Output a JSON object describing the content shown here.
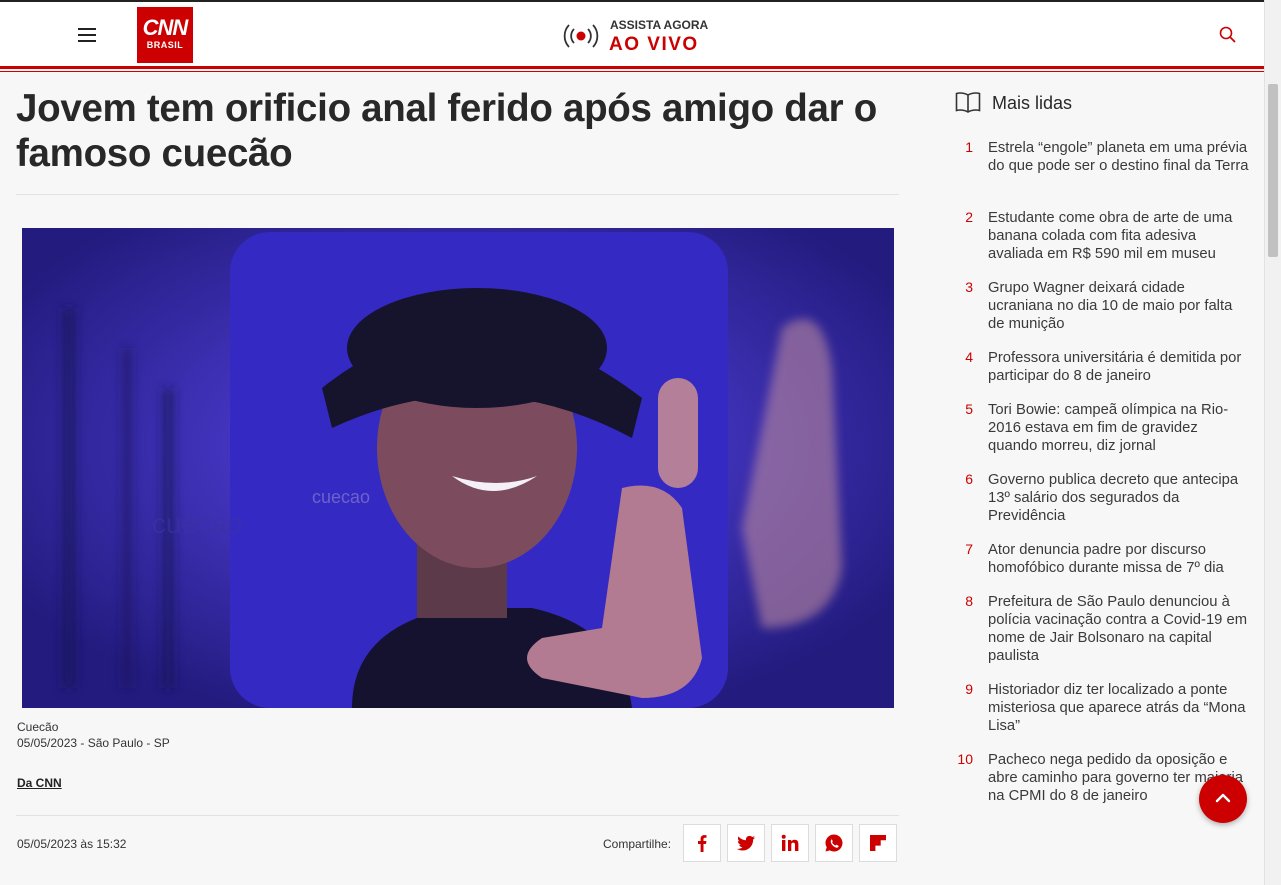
{
  "header": {
    "logo_main": "CNN",
    "logo_sub": "BRASIL",
    "live_top": "ASSISTA AGORA",
    "live_bottom": "AO VIVO"
  },
  "article": {
    "headline": "Jovem tem orificio anal ferido após amigo dar o famoso cuecão",
    "photo_watermark": "cuecao",
    "caption_title": "Cuecão",
    "caption_meta": "05/05/2023 - São Paulo - SP",
    "byline": "Da CNN",
    "datetime": "05/05/2023 às 15:32",
    "share_label": "Compartilhe:"
  },
  "most_read": {
    "title": "Mais lidas",
    "items": [
      {
        "num": "1",
        "text": "Estrela “engole” planeta em uma prévia do que pode ser o destino final da Terra"
      },
      {
        "num": "2",
        "text": "Estudante come obra de arte de uma banana colada com fita adesiva avaliada em R$ 590 mil em museu"
      },
      {
        "num": "3",
        "text": "Grupo Wagner deixará cidade ucraniana no dia 10 de maio por falta de munição"
      },
      {
        "num": "4",
        "text": "Professora universitária é demitida por participar do 8 de janeiro"
      },
      {
        "num": "5",
        "text": "Tori Bowie: campeã olímpica na Rio-2016 estava em fim de gravidez quando morreu, diz jornal"
      },
      {
        "num": "6",
        "text": "Governo publica decreto que antecipa 13º salário dos segurados da Previdência"
      },
      {
        "num": "7",
        "text": "Ator denuncia padre por discurso homofóbico durante missa de 7º dia"
      },
      {
        "num": "8",
        "text": "Prefeitura de São Paulo denunciou à polícia vacinação contra a Covid-19 em nome de Jair Bolsonaro na capital paulista"
      },
      {
        "num": "9",
        "text": "Historiador diz ter localizado a ponte misteriosa que aparece atrás da “Mona Lisa”"
      },
      {
        "num": "10",
        "text": "Pacheco nega pedido da oposição e abre caminho para governo ter maioria na CPMI do 8 de janeiro"
      }
    ]
  },
  "colors": {
    "brand_red": "#cc0000",
    "text": "#282828"
  },
  "icons": [
    "menu-icon",
    "live-broadcast-icon",
    "search-icon",
    "book-icon",
    "facebook-icon",
    "twitter-icon",
    "linkedin-icon",
    "whatsapp-icon",
    "flipboard-icon",
    "arrow-up-icon"
  ]
}
